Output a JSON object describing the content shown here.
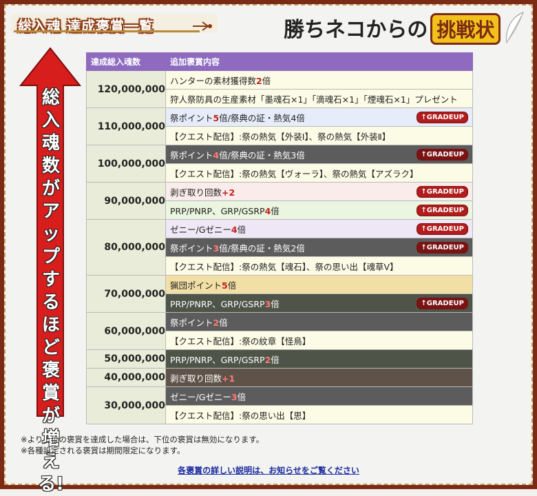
{
  "header": {
    "left_title": "総入魂 達成褒賞一覧",
    "right_title_main": "勝ちネコからの",
    "right_title_badge": "挑戦状"
  },
  "arrow": {
    "text": "総入魂数がアップするほど褒賞が増える!"
  },
  "table": {
    "col_count": "達成総入魂数",
    "col_reward": "追加褒賞内容",
    "grade_label": "↑GRADEUP"
  },
  "tiers": [
    {
      "count": "120,000,000",
      "rows": [
        {
          "pre": "ハンターの素材獲得数",
          "hl": "2",
          "post": "倍",
          "color": "cream",
          "grade": false
        },
        {
          "pre": "狩人祭防具の生産素材「墨魂石×1」「滴魂石×1」「煙魂石×1」プレゼント",
          "hl": "",
          "post": "",
          "color": "cream",
          "grade": false
        }
      ]
    },
    {
      "count": "110,000,000",
      "rows": [
        {
          "pre": "祭ポイント",
          "hl": "5",
          "post": "倍/祭典の証・熱気4倍",
          "color": "blue",
          "grade": true
        },
        {
          "pre": "【クエスト配信】:祭の熱気【外装Ⅰ】、祭の熱気【外装Ⅱ】",
          "hl": "",
          "post": "",
          "color": "cream",
          "grade": false
        }
      ]
    },
    {
      "count": "100,000,000",
      "rows": [
        {
          "pre": "祭ポイント",
          "hl": "4",
          "post": "倍/祭典の証・熱気3倍",
          "color": "dgrey",
          "grade": true
        },
        {
          "pre": "【クエスト配信】:祭の熱気【ヴォーラ】、祭の熱気【アズラク】",
          "hl": "",
          "post": "",
          "color": "cream",
          "grade": false
        }
      ]
    },
    {
      "count": "90,000,000",
      "rows": [
        {
          "pre": "剥ぎ取り回数",
          "hl": "+2",
          "post": "",
          "color": "pink",
          "grade": true
        },
        {
          "pre": "PRP/PNRP、GRP/GSRP",
          "hl": "4",
          "post": "倍",
          "color": "green",
          "grade": true
        }
      ]
    },
    {
      "count": "80,000,000",
      "rows": [
        {
          "pre": "ゼニー/Gゼニー",
          "hl": "4",
          "post": "倍",
          "color": "lav",
          "grade": true
        },
        {
          "pre": "祭ポイント",
          "hl": "3",
          "post": "倍/祭典の証・熱気2倍",
          "color": "dgrey",
          "grade": true
        },
        {
          "pre": "【クエスト配信】:祭の熱気【魂石】、祭の思い出【魂草Ⅴ】",
          "hl": "",
          "post": "",
          "color": "cream",
          "grade": false
        }
      ]
    },
    {
      "count": "70,000,000",
      "rows": [
        {
          "pre": "猟団ポイント",
          "hl": "5",
          "post": "倍",
          "color": "tan",
          "grade": false
        },
        {
          "pre": "PRP/PNRP、GRP/GSRP",
          "hl": "3",
          "post": "倍",
          "color": "olive",
          "grade": true
        }
      ]
    },
    {
      "count": "60,000,000",
      "rows": [
        {
          "pre": "祭ポイント",
          "hl": "2",
          "post": "倍",
          "color": "dgrey",
          "grade": false
        },
        {
          "pre": "【クエスト配信】:祭の紋章【怪鳥】",
          "hl": "",
          "post": "",
          "color": "cream",
          "grade": false
        }
      ]
    },
    {
      "count": "50,000,000",
      "rows": [
        {
          "pre": "PRP/PNRP、GRP/GSRP",
          "hl": "2",
          "post": "倍",
          "color": "olive",
          "grade": false
        }
      ]
    },
    {
      "count": "40,000,000",
      "rows": [
        {
          "pre": "剥ぎ取り回数",
          "hl": "+1",
          "post": "",
          "color": "brown",
          "grade": false
        }
      ]
    },
    {
      "count": "30,000,000",
      "rows": [
        {
          "pre": "ゼニー/Gゼニー",
          "hl": "3",
          "post": "倍",
          "color": "dgrey",
          "grade": false
        },
        {
          "pre": "【クエスト配信】:祭の思い出【思】",
          "hl": "",
          "post": "",
          "color": "cream",
          "grade": false
        }
      ]
    }
  ],
  "notes": [
    "※より上位の褒賞を達成した場合は、下位の褒賞は無効になります。",
    "※各種設定される褒賞は期間限定になります。"
  ],
  "detail_link": "各褒賞の詳しい説明は、お知らせをご覧ください"
}
